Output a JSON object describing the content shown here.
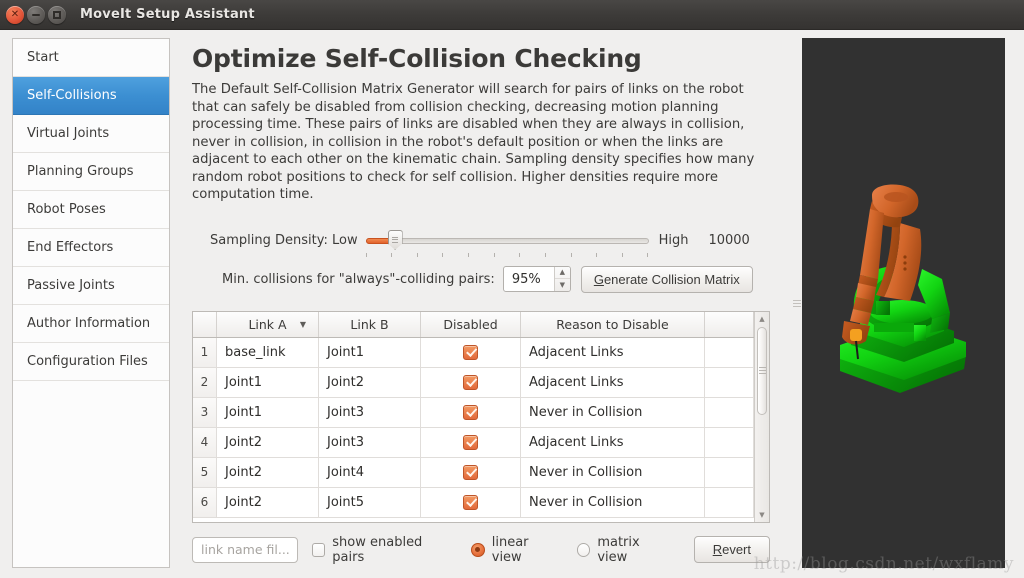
{
  "window": {
    "title": "MoveIt Setup Assistant",
    "controls": {
      "close": "close-button",
      "minimize": "minimize-button",
      "maximize": "maximize-button"
    }
  },
  "sidebar": {
    "items": [
      {
        "label": "Start",
        "selected": false
      },
      {
        "label": "Self-Collisions",
        "selected": true
      },
      {
        "label": "Virtual Joints",
        "selected": false
      },
      {
        "label": "Planning Groups",
        "selected": false
      },
      {
        "label": "Robot Poses",
        "selected": false
      },
      {
        "label": "End Effectors",
        "selected": false
      },
      {
        "label": "Passive Joints",
        "selected": false
      },
      {
        "label": "Author Information",
        "selected": false
      },
      {
        "label": "Configuration Files",
        "selected": false
      }
    ]
  },
  "main": {
    "title": "Optimize Self-Collision Checking",
    "description": "The Default Self-Collision Matrix Generator will search for pairs of links on the robot that can safely be disabled from collision checking, decreasing motion planning processing time. These pairs of links are disabled when they are always in collision, never in collision, in collision in the robot's default position or when the links are adjacent to each other on the kinematic chain. Sampling density specifies how many random robot positions to check for self collision. Higher densities require more computation time.",
    "sampling": {
      "label": "Sampling Density: Low",
      "high_label": "High",
      "value": "10000",
      "fill_percent": 10
    },
    "min_collisions": {
      "label": "Min. collisions for \"always\"-colliding pairs:",
      "value": "95%",
      "generate_button": "Generate Collision Matrix",
      "generate_button_mnemonic": "G"
    },
    "table": {
      "columns": [
        "",
        "Link A",
        "Link B",
        "Disabled",
        "Reason to Disable",
        ""
      ],
      "sort_column": "Link A",
      "sort_direction": "descending",
      "rows": [
        {
          "num": "1",
          "link_a": "base_link",
          "link_b": "Joint1",
          "disabled": true,
          "reason": "Adjacent Links"
        },
        {
          "num": "2",
          "link_a": "Joint1",
          "link_b": "Joint2",
          "disabled": true,
          "reason": "Adjacent Links"
        },
        {
          "num": "3",
          "link_a": "Joint1",
          "link_b": "Joint3",
          "disabled": true,
          "reason": "Never in Collision"
        },
        {
          "num": "4",
          "link_a": "Joint2",
          "link_b": "Joint3",
          "disabled": true,
          "reason": "Adjacent Links"
        },
        {
          "num": "5",
          "link_a": "Joint2",
          "link_b": "Joint4",
          "disabled": true,
          "reason": "Never in Collision"
        },
        {
          "num": "6",
          "link_a": "Joint2",
          "link_b": "Joint5",
          "disabled": true,
          "reason": "Never in Collision"
        }
      ]
    },
    "bottom": {
      "filter_placeholder": "link name fil...",
      "show_enabled_pairs": {
        "label": "show enabled pairs",
        "checked": false
      },
      "linear_view": {
        "label": "linear view",
        "selected": true
      },
      "matrix_view": {
        "label": "matrix view",
        "selected": false
      },
      "revert_button": "Revert",
      "revert_button_mnemonic": "R"
    }
  },
  "viewport": {
    "background_color": "#313131",
    "robot_arm_color": "#d2662a",
    "robot_base_color": "#14c614"
  },
  "watermark": "http://blog.csdn.net/wxflamy",
  "colors": {
    "accent_orange": "#e2693a",
    "selection_blue": "#3c8fd2",
    "window_bg": "#f0efee",
    "titlebar": "#3d3b39"
  }
}
